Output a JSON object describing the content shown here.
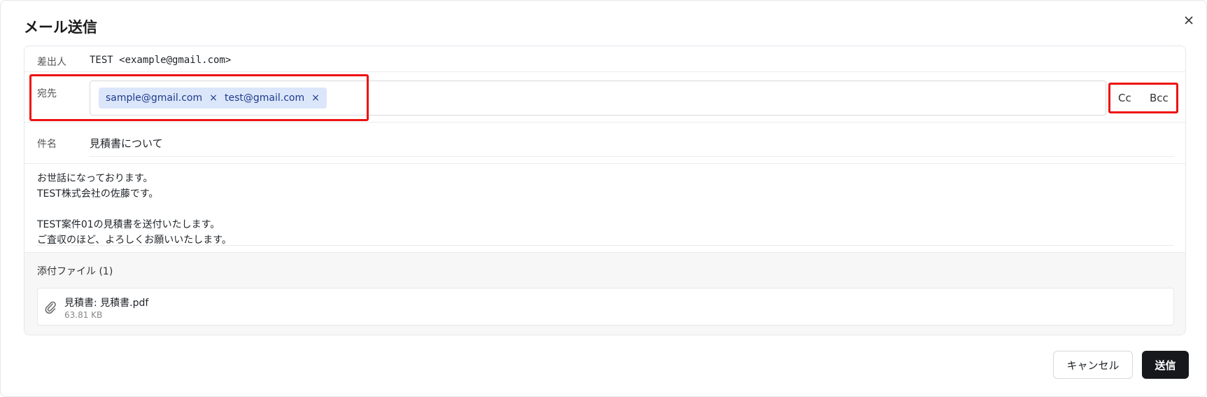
{
  "dialog": {
    "title": "メール送信",
    "close_icon": "close-icon"
  },
  "from": {
    "label": "差出人",
    "value": "TEST <example@gmail.com>"
  },
  "to": {
    "label": "宛先",
    "recipients": [
      {
        "email": "sample@gmail.com",
        "remove": "×"
      },
      {
        "email": "test@gmail.com",
        "remove": "×"
      }
    ],
    "cc_label": "Cc",
    "bcc_label": "Bcc"
  },
  "subject": {
    "label": "件名",
    "value": "見積書について"
  },
  "body": {
    "text": "お世話になっております。\nTEST株式会社の佐藤です。\n\nTEST案件01の見積書を送付いたします。\nご査収のほど、よろしくお願いいたします。"
  },
  "attachments": {
    "title": "添付ファイル (1)",
    "files": [
      {
        "icon": "paperclip-icon",
        "name": "見積書: 見積書.pdf",
        "size": "63.81 KB"
      }
    ]
  },
  "actions": {
    "cancel_label": "キャンセル",
    "send_label": "送信"
  },
  "colors": {
    "highlight": "#ee1111",
    "chip_bg": "#dbe6fb",
    "send_bg": "#16181c"
  }
}
